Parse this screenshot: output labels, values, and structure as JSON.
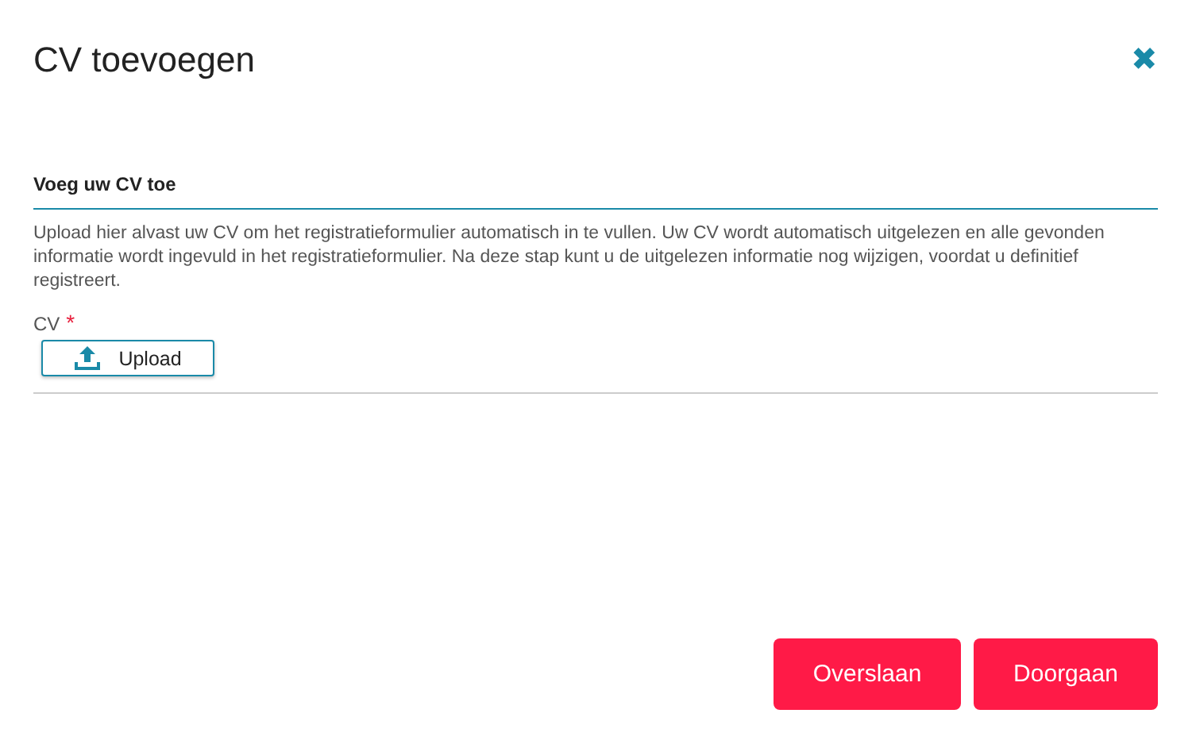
{
  "dialog": {
    "title": "CV toevoegen",
    "close_icon": "✖"
  },
  "section": {
    "heading": "Voeg uw CV toe",
    "description": "Upload hier alvast uw CV om het registratieformulier automatisch in te vullen. Uw CV wordt automatisch uitgelezen en alle gevonden informatie wordt ingevuld in het registratieformulier. Na deze stap kunt u de uitgelezen informatie nog wijzigen, voordat u definitief registreert."
  },
  "field": {
    "label": "CV",
    "required": true,
    "required_mark": "*",
    "button": "Upload"
  },
  "buttons": [
    "Overslaan",
    "Doorgaan"
  ]
}
